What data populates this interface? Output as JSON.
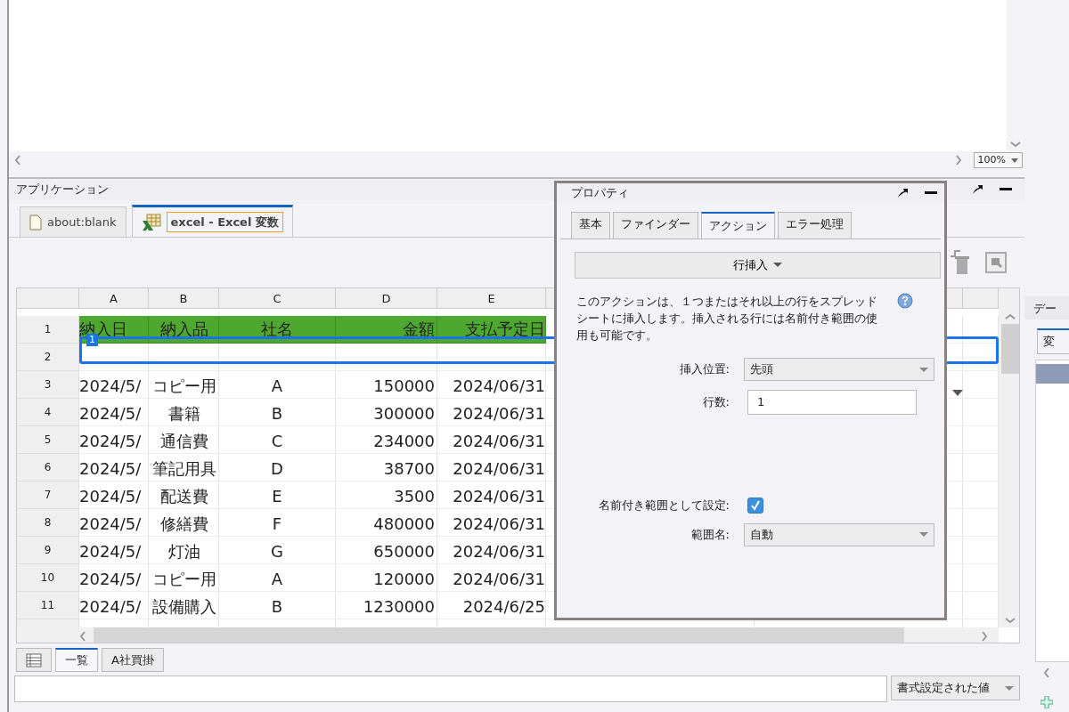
{
  "viewer": {
    "zoom": "100%"
  },
  "application": {
    "title": "アプリケーション",
    "tabs": [
      {
        "label": "about:blank",
        "selected": false,
        "kind": "page"
      },
      {
        "label": "excel - Excel 変数",
        "selected": true,
        "kind": "sheet"
      }
    ]
  },
  "spreadsheet": {
    "columns": [
      "A",
      "B",
      "C",
      "D",
      "E"
    ],
    "rows": [
      {
        "number": "1",
        "kind": "header",
        "cells": [
          "納入日",
          "納入品",
          "社名",
          "金額",
          "支払予定日"
        ]
      },
      {
        "number": "2",
        "kind": "inserted",
        "cells": []
      },
      {
        "number": "3",
        "kind": "data",
        "cells": [
          "2024/5/",
          "コピー用",
          "A",
          "150000",
          "2024/06/31"
        ]
      },
      {
        "number": "4",
        "kind": "data",
        "cells": [
          "2024/5/",
          "書籍",
          "B",
          "300000",
          "2024/06/31"
        ]
      },
      {
        "number": "5",
        "kind": "data",
        "cells": [
          "2024/5/",
          "通信費",
          "C",
          "234000",
          "2024/06/31"
        ]
      },
      {
        "number": "6",
        "kind": "data",
        "cells": [
          "2024/5/",
          "筆記用具",
          "D",
          "38700",
          "2024/06/31"
        ]
      },
      {
        "number": "7",
        "kind": "data",
        "cells": [
          "2024/5/",
          "配送費",
          "E",
          "3500",
          "2024/06/31"
        ]
      },
      {
        "number": "8",
        "kind": "data",
        "cells": [
          "2024/5/",
          "修繕費",
          "F",
          "480000",
          "2024/06/31"
        ]
      },
      {
        "number": "9",
        "kind": "data",
        "cells": [
          "2024/5/",
          "灯油",
          "G",
          "650000",
          "2024/06/31"
        ]
      },
      {
        "number": "10",
        "kind": "data",
        "cells": [
          "2024/5/",
          "コピー用",
          "A",
          "120000",
          "2024/06/31"
        ]
      },
      {
        "number": "11",
        "kind": "data",
        "cells": [
          "2024/5/",
          "設備購入",
          "B",
          "1230000",
          "2024/6/25"
        ]
      }
    ],
    "range_badge": "1",
    "sheet_tabs": [
      {
        "label": "一覧",
        "selected": true
      },
      {
        "label": "A社買掛",
        "selected": false
      }
    ]
  },
  "formula_bar": {
    "format": "書式設定された値"
  },
  "properties": {
    "title": "プロパティ",
    "tabs": [
      {
        "label": "基本",
        "selected": false
      },
      {
        "label": "ファインダー",
        "selected": false
      },
      {
        "label": "アクション",
        "selected": true
      },
      {
        "label": "エラー処理",
        "selected": false
      }
    ],
    "action": "行挿入",
    "description": "このアクションは、１つまたはそれ以上の行をスプレッドシートに挿入します。挿入される行には名前付き範囲の使用も可能です。",
    "fields": [
      {
        "kind": "select",
        "label": "挿入位置:",
        "value": "先頭"
      },
      {
        "kind": "input",
        "label": "行数:",
        "value": "1"
      },
      {
        "kind": "spacer"
      },
      {
        "kind": "checkbox",
        "label": "名前付き範囲として設定:",
        "checked": true
      },
      {
        "kind": "select",
        "label": "範囲名:",
        "value": "自動"
      }
    ]
  },
  "side_panel": {
    "title": "デー",
    "tab": "変"
  }
}
